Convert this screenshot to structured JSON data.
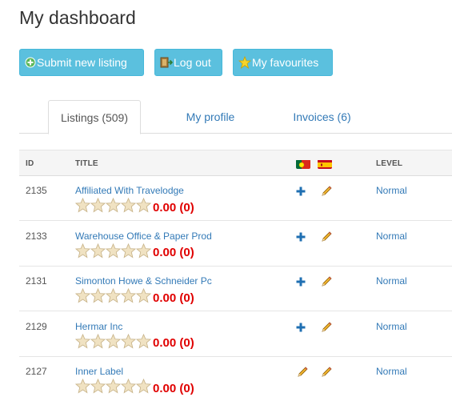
{
  "page_title": "My dashboard",
  "buttons": {
    "submit": "Submit new listing",
    "logout": "Log out",
    "favourites": "My favourites"
  },
  "tabs": {
    "listings": "Listings (509)",
    "profile": "My profile",
    "invoices": "Invoices (6)"
  },
  "table": {
    "headers": {
      "id": "ID",
      "title": "TITLE",
      "level": "LEVEL"
    },
    "flags": [
      "portugal-flag-icon",
      "spain-flag-icon"
    ],
    "rows": [
      {
        "id": "2135",
        "title": "Affiliated With Travelodge",
        "rating": "0.00 (0)",
        "stars": 0,
        "action1": "plus-icon",
        "level": "Normal"
      },
      {
        "id": "2133",
        "title": "Warehouse Office & Paper Prod",
        "rating": "0.00 (0)",
        "stars": 0,
        "action1": "plus-icon",
        "level": "Normal"
      },
      {
        "id": "2131",
        "title": "Simonton Howe & Schneider Pc",
        "rating": "0.00 (0)",
        "stars": 0,
        "action1": "plus-icon",
        "level": "Normal"
      },
      {
        "id": "2129",
        "title": "Hermar Inc",
        "rating": "0.00 (0)",
        "stars": 0,
        "action1": "plus-icon",
        "level": "Normal"
      },
      {
        "id": "2127",
        "title": "Inner Label",
        "rating": "0.00 (0)",
        "stars": 0,
        "action1": "pencil-icon",
        "level": "Normal"
      }
    ]
  },
  "colors": {
    "button_bg": "#5bc0de",
    "link": "#337ab7",
    "rating": "#e00000"
  }
}
